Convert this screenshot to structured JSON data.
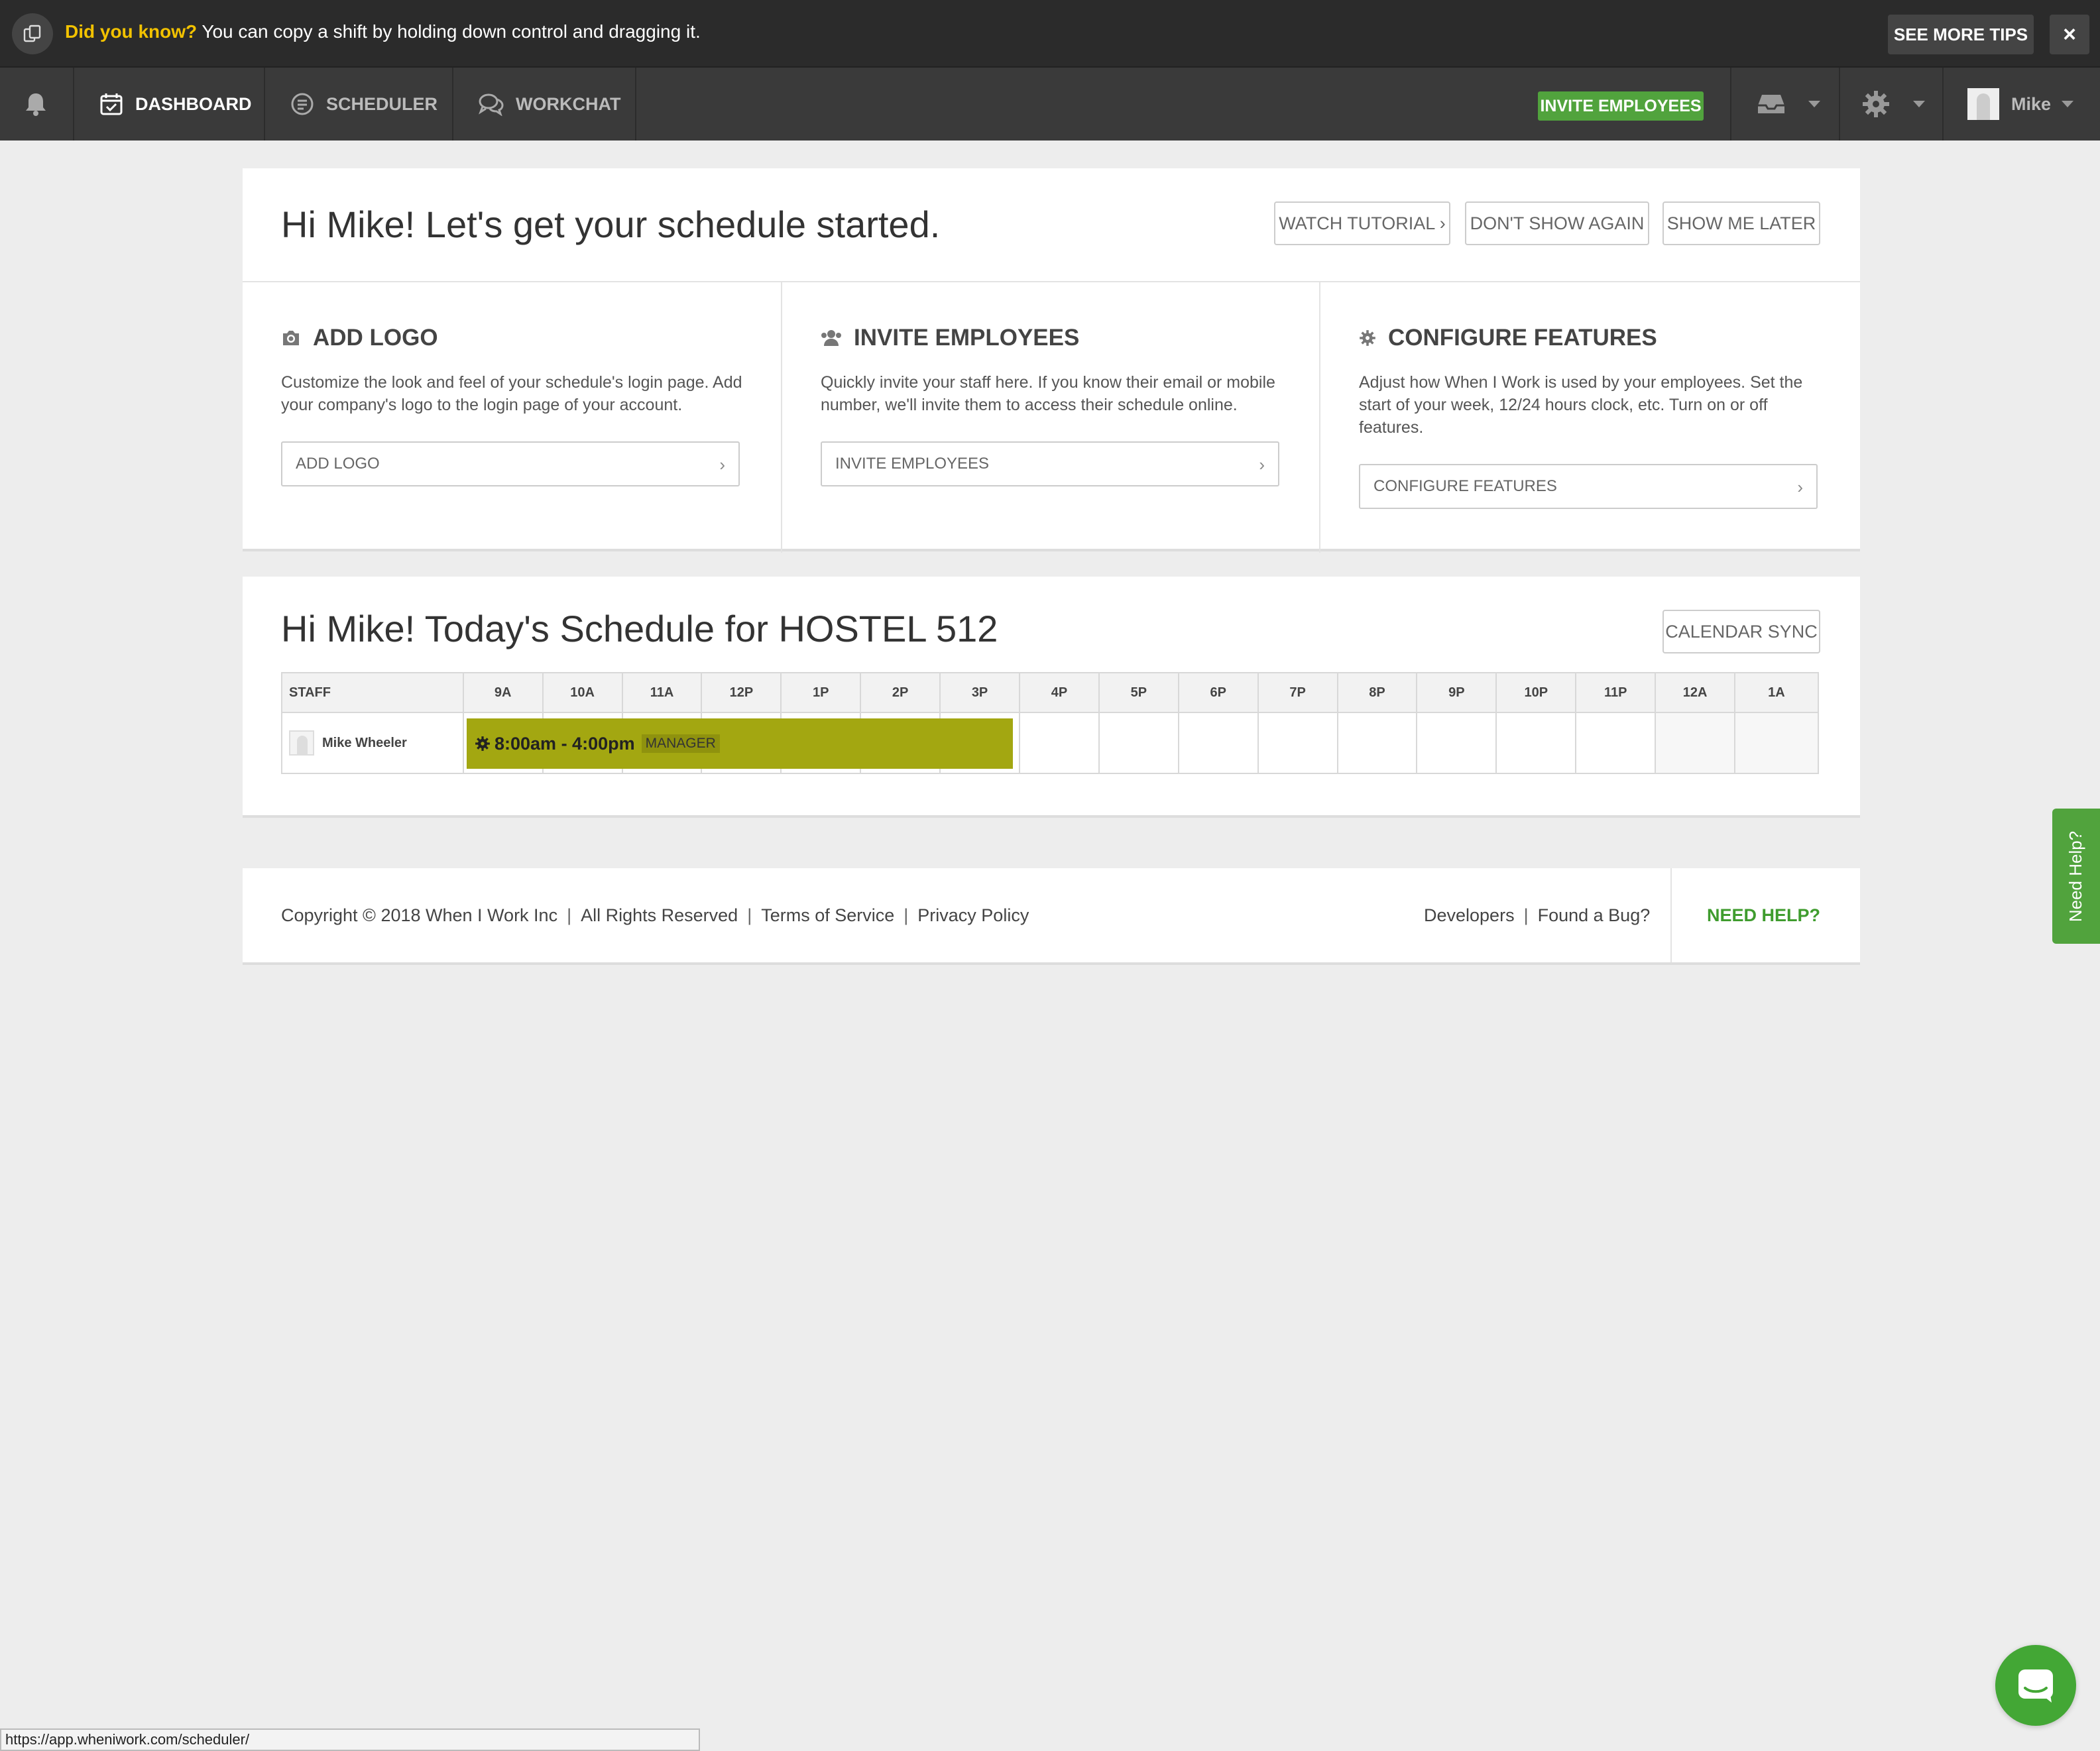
{
  "tipbar": {
    "highlight": "Did you know?",
    "message": " You can copy a shift by holding down control and dragging it.",
    "see_more": "SEE MORE TIPS",
    "close": "×"
  },
  "nav": {
    "dashboard": "DASHBOARD",
    "scheduler": "SCHEDULER",
    "workchat": "WORKCHAT",
    "invite": "INVITE EMPLOYEES",
    "user": "Mike"
  },
  "welcome": {
    "title": "Hi Mike! Let's get your schedule started.",
    "watch_tutorial": "WATCH TUTORIAL ›",
    "dont_show": "DON'T SHOW AGAIN",
    "show_later": "SHOW ME LATER",
    "sections": [
      {
        "heading": "ADD LOGO",
        "description": "Customize the look and feel of your schedule's login page. Add your company's logo to the login page of your account.",
        "button": "ADD LOGO"
      },
      {
        "heading": "INVITE EMPLOYEES",
        "description": "Quickly invite your staff here. If you know their email or mobile number, we'll invite them to access their schedule online.",
        "button": "INVITE EMPLOYEES"
      },
      {
        "heading": "CONFIGURE FEATURES",
        "description": "Adjust how When I Work is used by your employees. Set the start of your week, 12/24 hours clock, etc. Turn on or off features.",
        "button": "CONFIGURE FEATURES"
      }
    ]
  },
  "schedule": {
    "title": "Hi Mike! Today's Schedule for HOSTEL 512",
    "calendar_sync": "CALENDAR SYNC",
    "staff_header": "STAFF",
    "hours": [
      "9A",
      "10A",
      "11A",
      "12P",
      "1P",
      "2P",
      "3P",
      "4P",
      "5P",
      "6P",
      "7P",
      "8P",
      "9P",
      "10P",
      "11P",
      "12A",
      "1A"
    ],
    "rows": [
      {
        "name": "Mike Wheeler",
        "shift_time": "8:00am - 4:00pm",
        "shift_role": "MANAGER"
      }
    ]
  },
  "footer": {
    "copyright": "Copyright © 2018 When I Work Inc",
    "rights": "All Rights Reserved",
    "terms": "Terms of Service",
    "privacy": "Privacy Policy",
    "developers": "Developers",
    "bug": "Found a Bug?",
    "need_help": "NEED HELP?",
    "sep": "|"
  },
  "side_help": "Need Help?",
  "status_url": "https://app.wheniwork.com/scheduler/",
  "colors": {
    "accent_green": "#51a33d",
    "shift_olive": "#a3a711",
    "tip_yellow": "#f2c200",
    "nav_bg": "#3a3a3a"
  }
}
